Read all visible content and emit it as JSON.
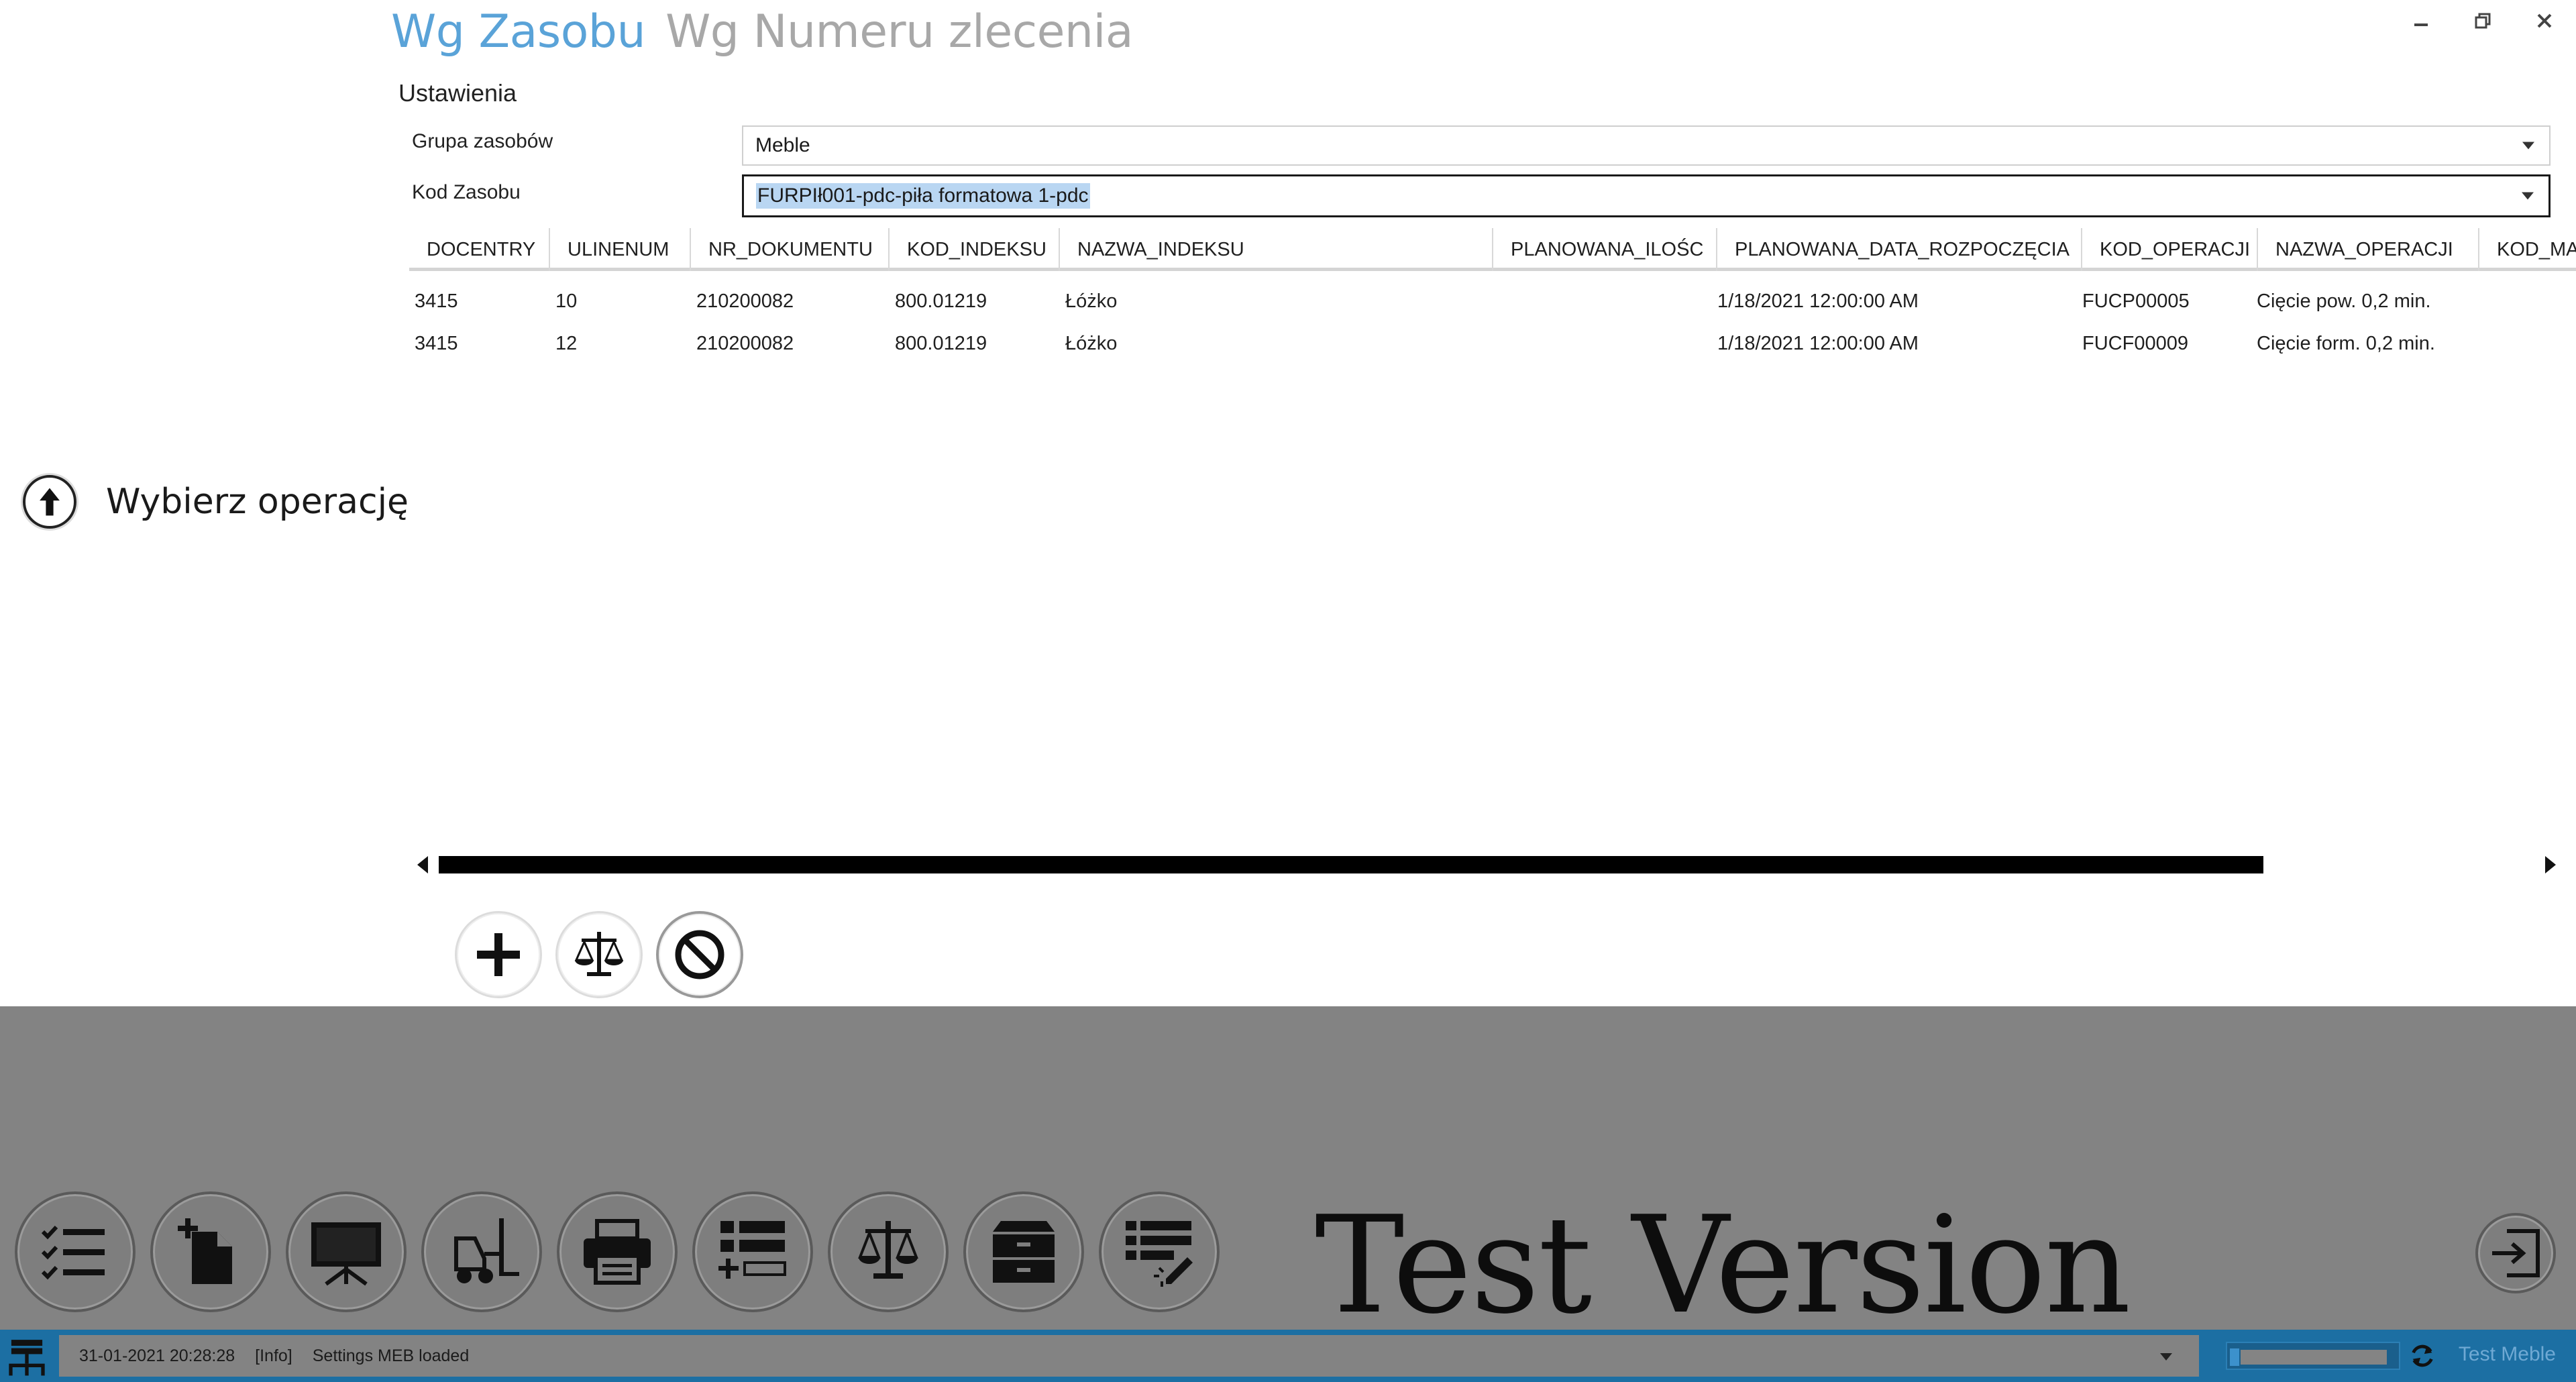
{
  "header": {
    "pivot_active": "Wg Zasobu",
    "pivot_inactive": "Wg Numeru zlecenia"
  },
  "window_controls": {
    "minimize_icon": "minimize-icon",
    "restore_icon": "restore-icon",
    "close_icon": "close-icon"
  },
  "settings": {
    "title": "Ustawienia",
    "group_label": "Grupa zasobów",
    "group_value": "Meble",
    "code_label": "Kod Zasobu",
    "code_value": "FURPIł001-pdc-piła formatowa 1-pdc"
  },
  "grid": {
    "columns": [
      "DOCENTRY",
      "ULINENUM",
      "NR_DOKUMENTU",
      "KOD_INDEKSU",
      "NAZWA_INDEKSU",
      "PLANOWANA_ILOŚC",
      "PLANOWANA_DATA_ROZPOCZĘCIA",
      "KOD_OPERACJI",
      "NAZWA_OPERACJI",
      "KOD_MAT"
    ],
    "rows": [
      [
        "3415",
        "10",
        "210200082",
        "800.01219",
        "Łóżko",
        "",
        "1/18/2021 12:00:00 AM",
        "FUCP00005",
        "Cięcie pow. 0,2 min.",
        ""
      ],
      [
        "3415",
        "12",
        "210200082",
        "800.01219",
        "Łóżko",
        "",
        "1/18/2021 12:00:00 AM",
        "FUCF00009",
        "Cięcie form. 0,2 min.",
        ""
      ]
    ]
  },
  "hint": {
    "text": "Wybierz operację",
    "icon": "arrow-up-icon"
  },
  "actions": [
    "plus-icon",
    "scales-icon",
    "cancel-icon"
  ],
  "toolbar_icons": [
    "checklist-icon",
    "new-document-icon",
    "presentation-board-icon",
    "forklift-icon",
    "printer-icon",
    "list-add-icon",
    "scales-icon",
    "drawer-icon",
    "list-edit-icon"
  ],
  "watermark": "Test Version",
  "status": {
    "timestamp": "31-01-2021 20:28:28",
    "level": "[Info]",
    "message": "Settings MEB loaded",
    "database": "Test Meble"
  }
}
